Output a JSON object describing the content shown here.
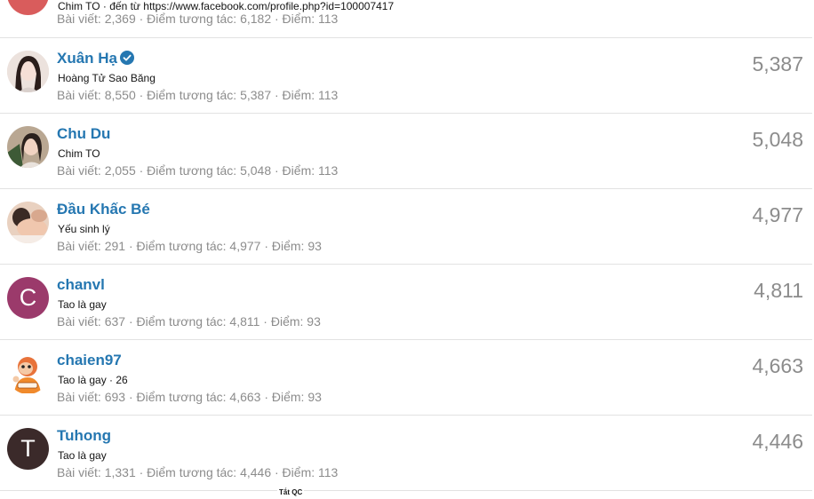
{
  "top_partial": {
    "avatar_color": "#d95c5c",
    "title": "Chim TO · đến từ https://www.facebook.com/profile.php?id=100007417",
    "stats": "Bài viết: 2,369 · Điểm tương tác: 6,182 · Điểm: 113"
  },
  "members": [
    {
      "name": "Xuân Hạ",
      "verified": true,
      "title": "Hoàng Tử Sao Băng",
      "stats": "Bài viết: 8,550 · Điểm tương tác: 5,387 · Điểm: 113",
      "score": "5,387",
      "avatar": {
        "type": "photo",
        "bg": "#e8d6d0"
      }
    },
    {
      "name": "Chu Du",
      "verified": false,
      "title": "Chim TO",
      "stats": "Bài viết: 2,055 · Điểm tương tác: 5,048 · Điểm: 113",
      "score": "5,048",
      "avatar": {
        "type": "photo",
        "bg": "#c9b7a4"
      }
    },
    {
      "name": "Đầu Khấc Bé",
      "verified": false,
      "title": "Yếu sinh lý",
      "stats": "Bài viết: 291 · Điểm tương tác: 4,977 · Điểm: 93",
      "score": "4,977",
      "avatar": {
        "type": "photo",
        "bg": "#e4c3ae"
      }
    },
    {
      "name": "chanvl",
      "verified": false,
      "title": "Tao là gay",
      "stats": "Bài viết: 637 · Điểm tương tác: 4,811 · Điểm: 93",
      "score": "4,811",
      "avatar": {
        "type": "letter",
        "letter": "C",
        "bg": "#9b3a6b"
      }
    },
    {
      "name": "chaien97",
      "verified": false,
      "title": "Tao là gay · 26",
      "stats": "Bài viết: 693 · Điểm tương tác: 4,663 · Điểm: 93",
      "score": "4,663",
      "avatar": {
        "type": "cartoon",
        "bg": "#ffffff"
      }
    },
    {
      "name": "Tuhong",
      "verified": false,
      "title": "Tao là gay",
      "stats": "Bài viết: 1,331 · Điểm tương tác: 4,446 · Điểm: 113",
      "score": "4,446",
      "avatar": {
        "type": "letter",
        "letter": "T",
        "bg": "#3b2a2a"
      }
    }
  ],
  "footer": {
    "label": "Tắt QC"
  }
}
